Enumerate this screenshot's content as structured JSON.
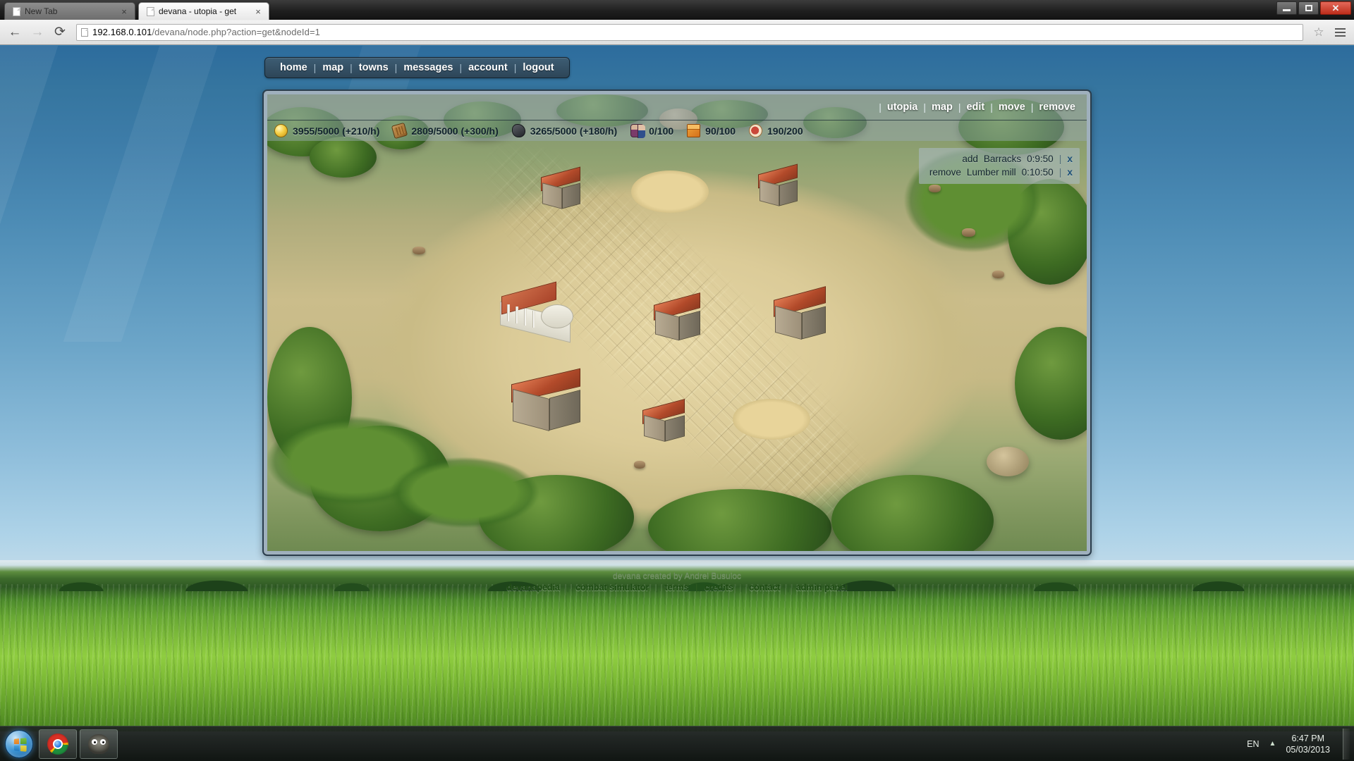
{
  "browser": {
    "tabs": [
      {
        "title": "New Tab",
        "active": false,
        "close_label": "×"
      },
      {
        "title": "devana - utopia - get",
        "active": true,
        "close_label": "×"
      }
    ],
    "window_controls": {
      "minimize": "–",
      "restore": "❐",
      "close": "✕"
    },
    "nav": {
      "back": "←",
      "forward": "→",
      "reload": "⟳"
    },
    "url": {
      "full": "192.168.0.101/devana/node.php?action=get&nodeId=1",
      "host": "192.168.0.101",
      "path": "/devana/node.php?action=get&nodeId=1"
    },
    "star": "☆",
    "menu": "menu"
  },
  "sitenav": {
    "separator": "|",
    "items": [
      {
        "label": "home"
      },
      {
        "label": "map"
      },
      {
        "label": "towns"
      },
      {
        "label": "messages"
      },
      {
        "label": "account"
      },
      {
        "label": "logout"
      }
    ]
  },
  "game": {
    "topmenu": {
      "separator": "|",
      "items": [
        {
          "label": "utopia"
        },
        {
          "label": "map"
        },
        {
          "label": "edit"
        },
        {
          "label": "move"
        },
        {
          "label": "remove"
        }
      ]
    },
    "resources": [
      {
        "icon": "gold-coin-icon",
        "name": "gold",
        "value": "3955/5000 (+210/h)"
      },
      {
        "icon": "wood-icon",
        "name": "wood",
        "value": "2809/5000 (+300/h)"
      },
      {
        "icon": "iron-icon",
        "name": "iron",
        "value": "3265/5000 (+180/h)"
      },
      {
        "icon": "population-icon",
        "name": "population",
        "value": "0/100"
      },
      {
        "icon": "storage-icon",
        "name": "storage",
        "value": "90/100"
      },
      {
        "icon": "food-icon",
        "name": "food",
        "value": "190/200"
      }
    ],
    "queue": {
      "separator": "|",
      "cancel_label": "x",
      "items": [
        {
          "action": "add",
          "building": "Barracks",
          "time": "0:9:50"
        },
        {
          "action": "remove",
          "building": "Lumber mill",
          "time": "0:10:50"
        }
      ]
    }
  },
  "footer": {
    "credit": "devana created by Andrei Busuioc",
    "separator": "|",
    "links": [
      {
        "label": "devanapedia"
      },
      {
        "label": "combat simulator"
      },
      {
        "label": "terms"
      },
      {
        "label": "credits"
      },
      {
        "label": "contact"
      },
      {
        "label": "admin panel"
      }
    ]
  },
  "taskbar": {
    "start": "start-orb",
    "items": [
      {
        "name": "chrome-taskbar-icon",
        "label": "Google Chrome"
      },
      {
        "name": "gimp-taskbar-icon",
        "label": "GIMP"
      }
    ],
    "tray": {
      "language": "EN",
      "caret": "▲",
      "time": "6:47 PM",
      "date": "05/03/2013"
    }
  },
  "colors": {
    "accent": "#2d4558",
    "page_sky": "#3d7ca8",
    "grass": "#8fcd40",
    "close_button": "#bd2d1b",
    "link": "#1d4a12"
  }
}
